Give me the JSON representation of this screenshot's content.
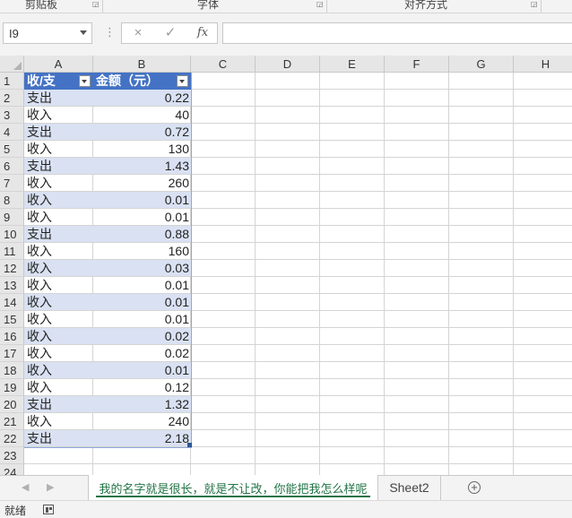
{
  "ribbon": {
    "groups": [
      {
        "label": "剪贴板"
      },
      {
        "label": "字体"
      },
      {
        "label": "对齐方式"
      }
    ]
  },
  "formula_bar": {
    "name_box": "I9",
    "cancel_icon": "×",
    "enter_icon": "✓",
    "fx_label": "fx",
    "formula_value": ""
  },
  "grid": {
    "columns": [
      "A",
      "B",
      "C",
      "D",
      "E",
      "F",
      "G",
      "H"
    ],
    "row_numbers": [
      "1",
      "2",
      "3",
      "4",
      "5",
      "6",
      "7",
      "8",
      "9",
      "10",
      "11",
      "12",
      "13",
      "14",
      "15",
      "16",
      "17",
      "18",
      "19",
      "20",
      "21",
      "22",
      "23",
      "24"
    ],
    "table_header": {
      "a": "收/支",
      "b": "金额（元）"
    },
    "rows": [
      {
        "a": "支出",
        "b": "0.22"
      },
      {
        "a": "收入",
        "b": "40"
      },
      {
        "a": "支出",
        "b": "0.72"
      },
      {
        "a": "收入",
        "b": "130"
      },
      {
        "a": "支出",
        "b": "1.43"
      },
      {
        "a": "收入",
        "b": "260"
      },
      {
        "a": "收入",
        "b": "0.01"
      },
      {
        "a": "收入",
        "b": "0.01"
      },
      {
        "a": "支出",
        "b": "0.88"
      },
      {
        "a": "收入",
        "b": "160"
      },
      {
        "a": "收入",
        "b": "0.03"
      },
      {
        "a": "收入",
        "b": "0.01"
      },
      {
        "a": "收入",
        "b": "0.01"
      },
      {
        "a": "收入",
        "b": "0.01"
      },
      {
        "a": "收入",
        "b": "0.02"
      },
      {
        "a": "收入",
        "b": "0.02"
      },
      {
        "a": "收入",
        "b": "0.01"
      },
      {
        "a": "收入",
        "b": "0.12"
      },
      {
        "a": "支出",
        "b": "1.32"
      },
      {
        "a": "收入",
        "b": "240"
      },
      {
        "a": "支出",
        "b": "2.18"
      }
    ],
    "band_color": "#d9e1f2",
    "header_color": "#4472c4"
  },
  "sheet_tabs": {
    "tabs": [
      {
        "label": "我的名字就是很长，就是不让改，你能把我怎么样呢",
        "active": true
      },
      {
        "label": "Sheet2",
        "active": false
      }
    ],
    "add_icon": "⊕"
  },
  "status_bar": {
    "status": "就绪"
  },
  "accent_color": "#217346"
}
